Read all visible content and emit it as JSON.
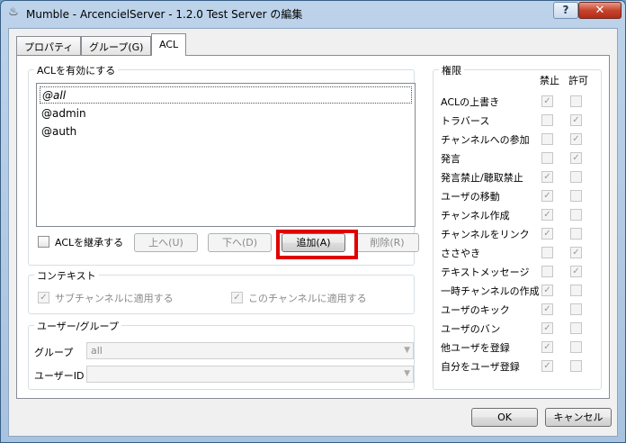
{
  "window": {
    "title": "Mumble - ArcencielServer - 1.2.0 Test Server の編集",
    "help": "?",
    "close": "✕",
    "app_icon": "mumble-icon"
  },
  "tabs": [
    {
      "label": "プロパティ",
      "active": false
    },
    {
      "label": "グループ(G)",
      "active": false
    },
    {
      "label": "ACL",
      "active": true
    }
  ],
  "acl_group": {
    "label": "ACLを有効にする",
    "entries": [
      "@all",
      "@admin",
      "@auth"
    ],
    "selected_index": 0,
    "inherit_label": "ACLを継承する",
    "inherit_checked": false,
    "buttons": {
      "up": "上へ(U)",
      "down": "下へ(D)",
      "add": "追加(A)",
      "remove": "削除(R)"
    }
  },
  "context_group": {
    "label": "コンテキスト",
    "apply_sub": "サブチャンネルに適用する",
    "apply_this": "このチャンネルに適用する"
  },
  "user_group": {
    "label": "ユーザー/グループ",
    "group_label": "グループ",
    "group_value": "all",
    "userid_label": "ユーザーID",
    "userid_value": ""
  },
  "permissions": {
    "label": "権限",
    "deny_header": "禁止",
    "allow_header": "許可",
    "rows": [
      {
        "name": "ACLの上書き",
        "deny": true,
        "allow": false
      },
      {
        "name": "トラバース",
        "deny": false,
        "allow": true
      },
      {
        "name": "チャンネルへの参加",
        "deny": false,
        "allow": true
      },
      {
        "name": "発言",
        "deny": false,
        "allow": true
      },
      {
        "name": "発言禁止/聴取禁止",
        "deny": true,
        "allow": false
      },
      {
        "name": "ユーザの移動",
        "deny": true,
        "allow": false
      },
      {
        "name": "チャンネル作成",
        "deny": true,
        "allow": false
      },
      {
        "name": "チャンネルをリンク",
        "deny": true,
        "allow": false
      },
      {
        "name": "ささやき",
        "deny": false,
        "allow": true
      },
      {
        "name": "テキストメッセージ",
        "deny": false,
        "allow": true
      },
      {
        "name": "一時チャンネルの作成",
        "deny": true,
        "allow": false
      },
      {
        "name": "ユーザのキック",
        "deny": true,
        "allow": false
      },
      {
        "name": "ユーザのバン",
        "deny": true,
        "allow": false
      },
      {
        "name": "他ユーザを登録",
        "deny": true,
        "allow": false
      },
      {
        "name": "自分をユーザ登録",
        "deny": true,
        "allow": false
      }
    ]
  },
  "footer": {
    "ok": "OK",
    "cancel": "キャンセル"
  },
  "colors": {
    "highlight": "#e00000"
  }
}
